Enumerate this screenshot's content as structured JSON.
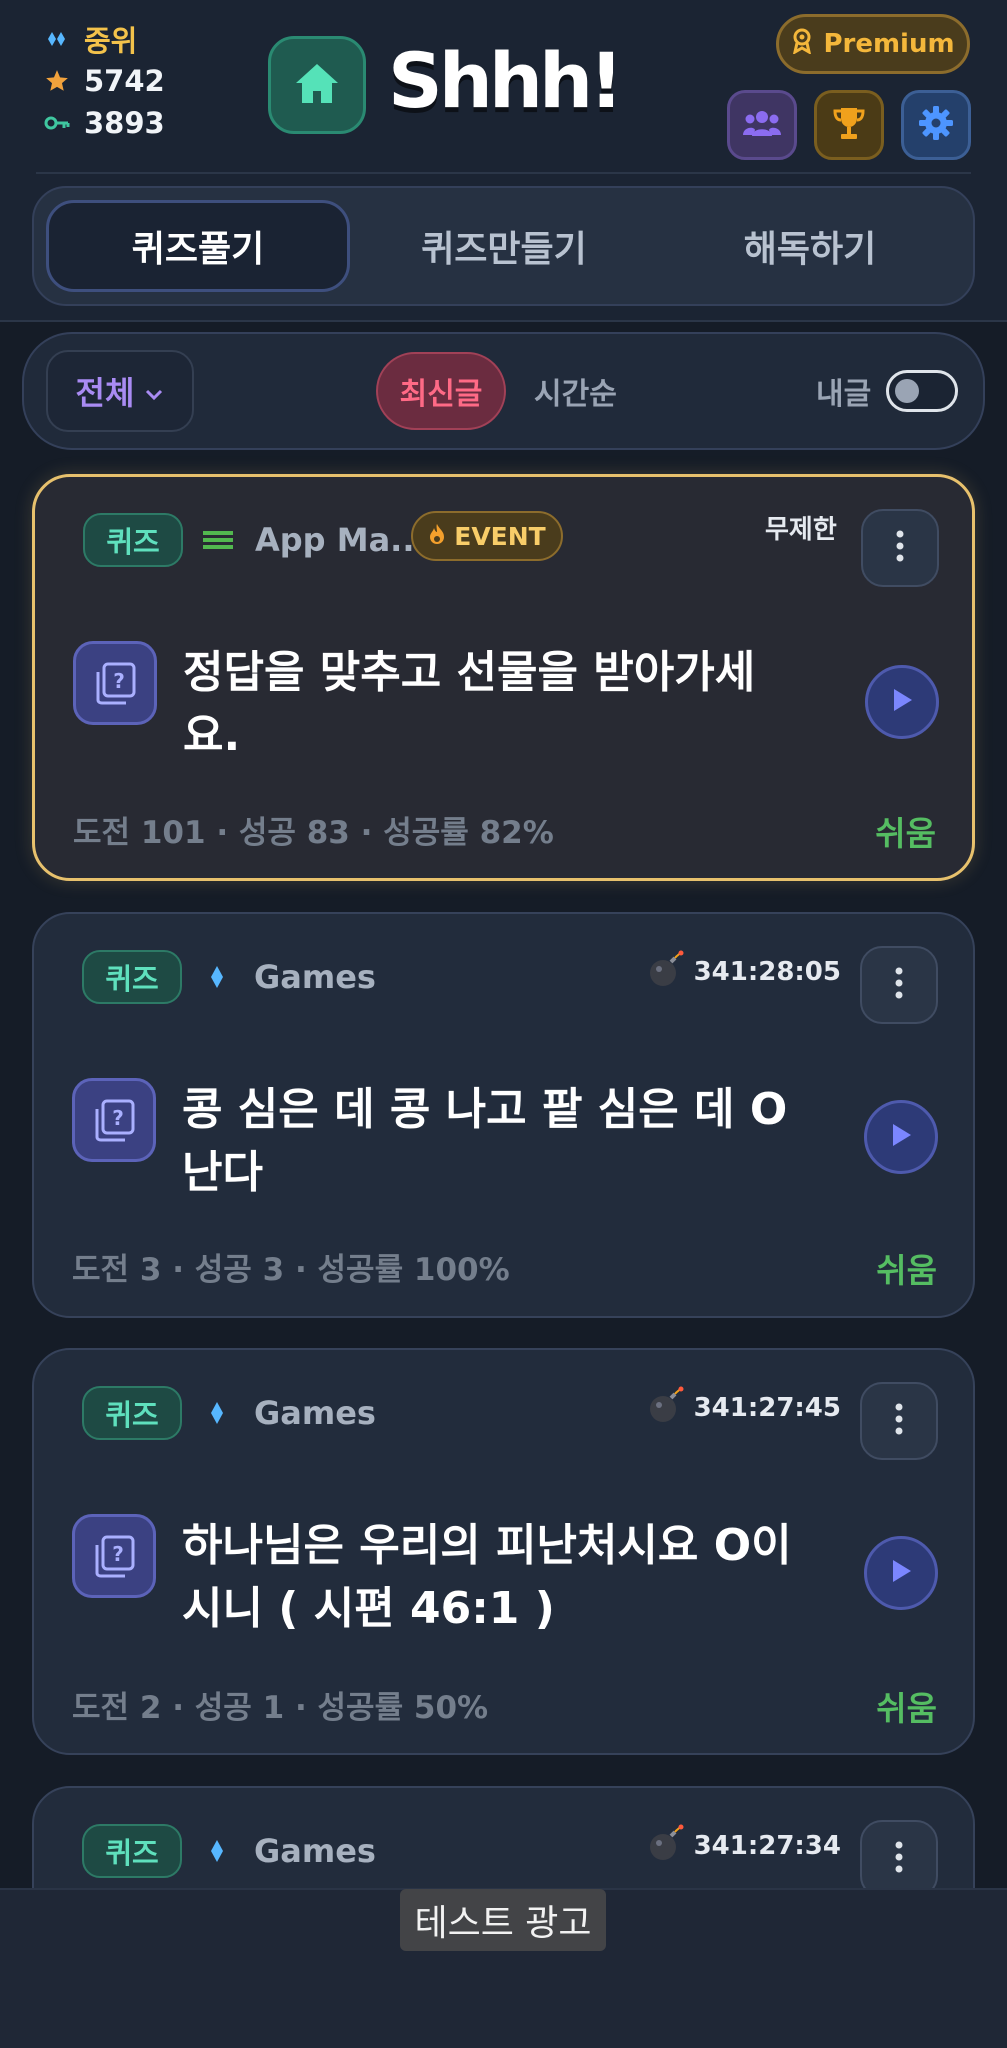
{
  "header": {
    "rank_text": "중위",
    "stars": "5742",
    "keys": "3893",
    "logo": "Shhh!",
    "premium_label": "Premium"
  },
  "tabs": [
    {
      "label": "퀴즈풀기",
      "active": true
    },
    {
      "label": "퀴즈만들기",
      "active": false
    },
    {
      "label": "해독하기",
      "active": false
    }
  ],
  "filters": {
    "category": "전체",
    "sort_latest": "최신글",
    "sort_time": "시간순",
    "mine": "내글",
    "mine_toggle_on": false
  },
  "cards": [
    {
      "tag": "퀴즈",
      "category": "App Ma...",
      "event": "EVENT",
      "time": "무제한",
      "question": "정답을 맞추고 선물을 받아가세요.",
      "stats": "도전 101 · 성공 83 · 성공률 82%",
      "difficulty": "쉬움"
    },
    {
      "tag": "퀴즈",
      "category": "Games",
      "timer": "341:28:05",
      "question": "콩 심은 데 콩 나고 팥 심은 데 O 난다",
      "stats": "도전 3 · 성공 3 · 성공률 100%",
      "difficulty": "쉬움"
    },
    {
      "tag": "퀴즈",
      "category": "Games",
      "timer": "341:27:45",
      "question": "하나님은 우리의 피난처시요 O이시니 ( 시편 46:1 )",
      "stats": "도전 2 · 성공 1 · 성공률 50%",
      "difficulty": "쉬움"
    },
    {
      "tag": "퀴즈",
      "category": "Games",
      "timer": "341:27:34"
    }
  ],
  "ad": {
    "label": "테스트 광고"
  },
  "colors": {
    "accent_green": "#5fe0bd",
    "accent_gold": "#f4b73b",
    "accent_pink": "#ff6a86",
    "difficulty_easy": "#55bd62",
    "event_border": "#e7c16d"
  },
  "icons": {
    "rank": "diamond-icon",
    "stars": "star-icon",
    "keys": "key-icon",
    "home": "home-icon",
    "premium": "medal-icon",
    "friends": "users-icon",
    "trophy": "trophy-icon",
    "settings": "gear-icon",
    "quiz": "quiz-book-icon",
    "play": "play-icon",
    "more": "more-vertical-icon",
    "bomb": "bomb-icon"
  }
}
